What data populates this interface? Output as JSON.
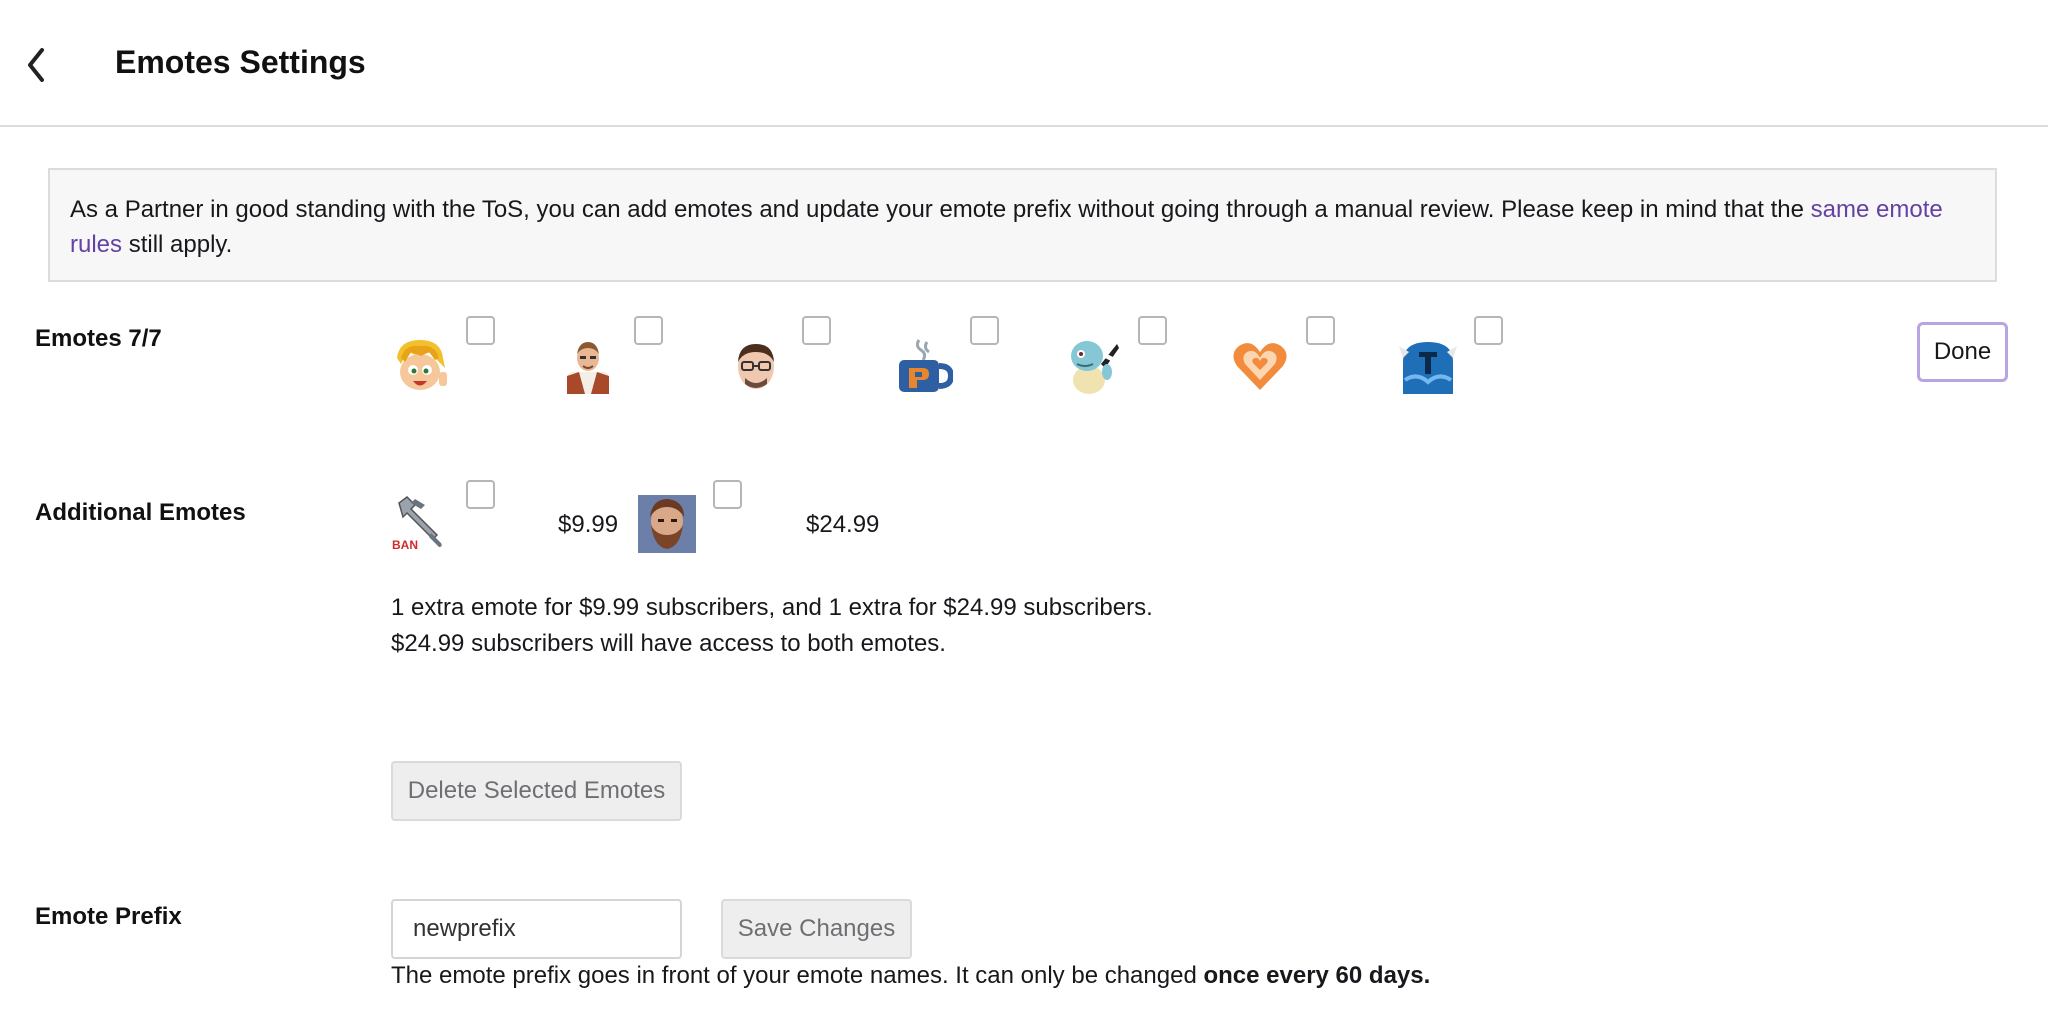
{
  "header": {
    "title": "Emotes Settings"
  },
  "notice": {
    "text_before": "As a Partner in good standing with the ToS, you can add emotes and update your emote prefix without going through a manual review. Please keep in mind that the ",
    "link_text": "same emote rules",
    "text_after": " still apply."
  },
  "emotes": {
    "label": "Emotes 7/7",
    "done_label": "Done",
    "items": [
      {
        "icon": "cartoon-face-emote",
        "selected": false
      },
      {
        "icon": "vest-person-emote",
        "selected": false
      },
      {
        "icon": "glasses-face-emote",
        "selected": false
      },
      {
        "icon": "mug-emote",
        "selected": false
      },
      {
        "icon": "squirtle-emote",
        "selected": false
      },
      {
        "icon": "heart-emote",
        "selected": false
      },
      {
        "icon": "knight-helmet-emote",
        "selected": false
      }
    ]
  },
  "additional": {
    "label": "Additional Emotes",
    "items": [
      {
        "icon": "wrench-ban-emote",
        "badge": "BAN",
        "price": "$9.99"
      },
      {
        "icon": "bearded-face-emote",
        "price": "$24.99"
      }
    ],
    "description_line1": "1 extra emote for $9.99 subscribers, and 1 extra for $24.99 subscribers.",
    "description_line2": "$24.99 subscribers will have access to both emotes."
  },
  "delete_button": "Delete Selected Emotes",
  "prefix": {
    "label": "Emote Prefix",
    "value": "newprefix",
    "save_label": "Save Changes",
    "help_text": "The emote prefix goes in front of your emote names. It can only be changed ",
    "help_bold": "once every 60 days."
  }
}
